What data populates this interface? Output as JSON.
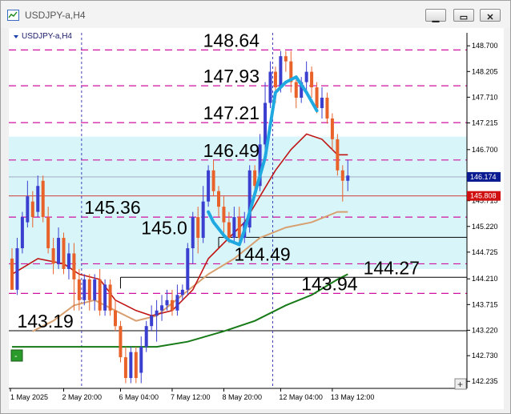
{
  "window": {
    "title": "USDJPY-a,H4",
    "buttons": [
      {
        "name": "minimize",
        "glyph": "▁"
      },
      {
        "name": "maximize",
        "glyph": "▭"
      },
      {
        "name": "close",
        "glyph": "✕"
      }
    ]
  },
  "chart_data": {
    "type": "candlestick",
    "symbol_label": "USDJPY-a,H4",
    "ylim": [
      142.1,
      148.95
    ],
    "y_ticks": [
      "148.700",
      "148.205",
      "147.710",
      "147.215",
      "146.700",
      "146.205",
      "145.715",
      "145.220",
      "144.725",
      "144.210",
      "143.715",
      "143.220",
      "142.730",
      "142.235"
    ],
    "x_ticks": [
      "1 May 2025",
      "2 May 20:00",
      "6 May 04:00",
      "7 May 12:00",
      "8 May 20:00",
      "12 May 04:00",
      "13 May 12:00"
    ],
    "bid_price": "146.174",
    "ask_price": "145.808",
    "colors": {
      "bull": "#3a3fd0",
      "bear": "#e8622a",
      "ma_fast": "#c01515",
      "ma_mid": "#d8a070",
      "ma_slow": "#167a16",
      "levels": "#d010a0",
      "zone": "#d8f6fa",
      "trend": "#1fa9e0"
    },
    "zone": {
      "from": 144.4,
      "to": 146.95
    },
    "level_lines": [
      148.62,
      147.93,
      147.22,
      146.5,
      145.4,
      144.5,
      143.93
    ],
    "support_lines": [
      {
        "price": 145.01,
        "from_candle": 40
      },
      {
        "price": 144.24,
        "from_candle": 21
      },
      {
        "price": 143.21,
        "from_candle": 0
      }
    ],
    "separators": [
      13,
      50
    ],
    "candles": [
      [
        144.6,
        144.0,
        144.8,
        144.0
      ],
      [
        144.0,
        144.8,
        145.0,
        143.9
      ],
      [
        144.8,
        145.4,
        145.5,
        144.7
      ],
      [
        145.3,
        145.8,
        146.1,
        145.2
      ],
      [
        145.7,
        145.4,
        145.9,
        145.2
      ],
      [
        145.5,
        146.0,
        146.2,
        145.4
      ],
      [
        146.1,
        145.4,
        146.2,
        145.3
      ],
      [
        145.4,
        144.8,
        145.6,
        144.7
      ],
      [
        144.8,
        144.5,
        145.0,
        144.3
      ],
      [
        144.5,
        145.0,
        145.2,
        144.4
      ],
      [
        145.0,
        144.4,
        145.1,
        144.3
      ],
      [
        144.4,
        144.7,
        144.9,
        144.2
      ],
      [
        144.7,
        144.2,
        144.9,
        143.6
      ],
      [
        144.2,
        143.8,
        144.4,
        143.6
      ],
      [
        143.8,
        144.2,
        144.3,
        143.7
      ],
      [
        144.2,
        143.8,
        144.3,
        143.6
      ],
      [
        143.8,
        144.2,
        144.3,
        143.6
      ],
      [
        144.2,
        143.6,
        144.4,
        143.5
      ],
      [
        143.6,
        144.1,
        144.2,
        143.5
      ],
      [
        144.1,
        143.6,
        144.2,
        143.5
      ],
      [
        143.6,
        143.3,
        143.8,
        143.2
      ],
      [
        143.3,
        142.7,
        143.4,
        142.6
      ],
      [
        142.7,
        142.3,
        142.9,
        142.2
      ],
      [
        142.3,
        142.8,
        142.9,
        142.2
      ],
      [
        142.8,
        142.3,
        142.9,
        142.2
      ],
      [
        142.4,
        142.9,
        143.1,
        142.2
      ],
      [
        142.9,
        143.3,
        143.4,
        142.8
      ],
      [
        143.3,
        143.5,
        143.7,
        143.2
      ],
      [
        143.5,
        143.6,
        143.8,
        143.0
      ],
      [
        143.6,
        143.7,
        143.9,
        143.4
      ],
      [
        143.7,
        143.8,
        144.0,
        143.6
      ],
      [
        143.8,
        143.6,
        144.0,
        143.5
      ],
      [
        143.6,
        143.9,
        144.1,
        143.5
      ],
      [
        143.9,
        144.0,
        144.1,
        143.8
      ],
      [
        144.0,
        144.8,
        144.9,
        143.9
      ],
      [
        144.8,
        145.4,
        145.5,
        144.5
      ],
      [
        145.4,
        145.0,
        145.6,
        144.7
      ],
      [
        145.0,
        145.7,
        146.0,
        144.9
      ],
      [
        145.7,
        146.3,
        146.4,
        145.6
      ],
      [
        146.3,
        145.9,
        146.5,
        145.8
      ],
      [
        145.9,
        145.6,
        146.0,
        145.4
      ],
      [
        145.6,
        145.3,
        145.8,
        145.1
      ],
      [
        145.3,
        145.0,
        145.5,
        144.9
      ],
      [
        145.0,
        145.4,
        145.6,
        144.9
      ],
      [
        145.4,
        145.0,
        145.6,
        144.9
      ],
      [
        145.0,
        145.3,
        145.5,
        144.9
      ],
      [
        145.2,
        146.3,
        146.4,
        145.1
      ],
      [
        146.3,
        146.0,
        146.4,
        145.9
      ],
      [
        146.0,
        146.8,
        147.0,
        145.9
      ],
      [
        146.8,
        147.6,
        148.0,
        146.6
      ],
      [
        147.6,
        148.2,
        148.4,
        147.5
      ],
      [
        148.2,
        147.9,
        148.3,
        147.6
      ],
      [
        147.9,
        148.5,
        148.6,
        147.8
      ],
      [
        148.5,
        148.4,
        148.6,
        148.2
      ],
      [
        148.4,
        148.0,
        148.6,
        147.8
      ],
      [
        148.0,
        147.7,
        148.1,
        147.5
      ],
      [
        147.7,
        148.0,
        148.1,
        147.6
      ],
      [
        148.0,
        148.2,
        148.4,
        147.8
      ],
      [
        148.2,
        147.9,
        148.3,
        147.7
      ],
      [
        147.9,
        147.5,
        148.0,
        147.4
      ],
      [
        147.5,
        147.7,
        147.9,
        147.3
      ],
      [
        147.7,
        147.3,
        147.8,
        147.2
      ],
      [
        147.3,
        146.9,
        147.4,
        146.7
      ],
      [
        146.9,
        146.3,
        147.0,
        146.2
      ],
      [
        146.3,
        146.1,
        146.4,
        145.7
      ],
      [
        146.1,
        146.2,
        146.5,
        145.9
      ]
    ],
    "ma_fast": [
      [
        0,
        144.3
      ],
      [
        5,
        144.6
      ],
      [
        10,
        144.5
      ],
      [
        13,
        144.3
      ],
      [
        17,
        144.2
      ],
      [
        20,
        143.8
      ],
      [
        24,
        143.6
      ],
      [
        27,
        143.5
      ],
      [
        31,
        143.6
      ],
      [
        35,
        144.0
      ],
      [
        38,
        144.6
      ],
      [
        42,
        145.0
      ],
      [
        45,
        145.3
      ],
      [
        48,
        145.8
      ],
      [
        51,
        146.3
      ],
      [
        54,
        146.7
      ],
      [
        57,
        147.0
      ],
      [
        60,
        146.9
      ],
      [
        63,
        146.6
      ],
      [
        65,
        146.6
      ]
    ],
    "ma_mid": [
      [
        4,
        143.2
      ],
      [
        8,
        143.4
      ],
      [
        12,
        143.7
      ],
      [
        16,
        143.8
      ],
      [
        20,
        143.6
      ],
      [
        24,
        143.4
      ],
      [
        28,
        143.5
      ],
      [
        33,
        143.9
      ],
      [
        38,
        144.3
      ],
      [
        43,
        144.6
      ],
      [
        48,
        145.0
      ],
      [
        53,
        145.2
      ],
      [
        58,
        145.3
      ],
      [
        63,
        145.5
      ],
      [
        65,
        145.5
      ]
    ],
    "ma_slow": [
      [
        0,
        142.9
      ],
      [
        10,
        142.9
      ],
      [
        20,
        142.9
      ],
      [
        28,
        142.9
      ],
      [
        34,
        143.0
      ],
      [
        41,
        143.2
      ],
      [
        47,
        143.4
      ],
      [
        53,
        143.7
      ],
      [
        58,
        143.9
      ],
      [
        63,
        144.2
      ],
      [
        65,
        144.3
      ]
    ],
    "trend_path": [
      [
        38,
        145.5
      ],
      [
        39,
        145.3
      ],
      [
        41,
        145.05
      ],
      [
        42,
        144.95
      ],
      [
        44,
        144.87
      ],
      [
        45,
        145.15
      ],
      [
        49,
        146.55
      ],
      [
        51,
        147.8
      ],
      [
        53,
        148.0
      ],
      [
        55,
        148.1
      ],
      [
        57,
        147.8
      ],
      [
        59,
        147.45
      ]
    ],
    "annotations": [
      {
        "text": "148.64",
        "price": 148.62,
        "candle": 37
      },
      {
        "text": "147.93",
        "price": 147.93,
        "candle": 37
      },
      {
        "text": "147.21",
        "price": 147.22,
        "candle": 37
      },
      {
        "text": "146.49",
        "price": 146.5,
        "candle": 37
      },
      {
        "text": "145.36",
        "price": 145.4,
        "candle": 14
      },
      {
        "text": "145.0",
        "price": 145.01,
        "candle": 25
      },
      {
        "text": "144.49",
        "price": 144.5,
        "candle": 43
      },
      {
        "text": "144.27",
        "price": 144.24,
        "candle": 68
      },
      {
        "text": "143.94",
        "price": 143.93,
        "candle": 56
      },
      {
        "text": "143.19",
        "price": 143.21,
        "candle": 1
      }
    ],
    "buttons": [
      {
        "name": "one-click-trade",
        "label": "-"
      },
      {
        "name": "zoom-plus",
        "label": "+"
      }
    ]
  }
}
